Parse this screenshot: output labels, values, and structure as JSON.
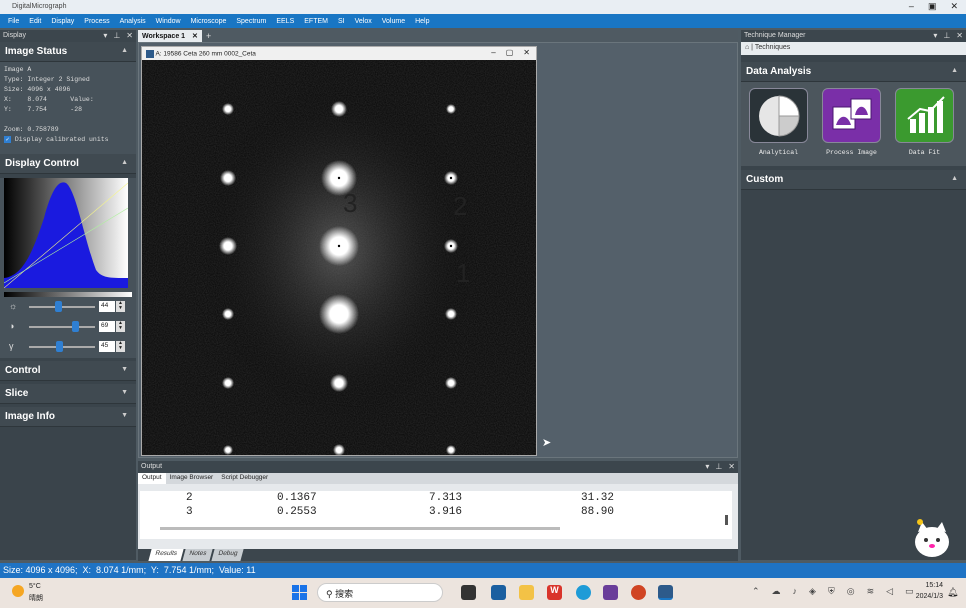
{
  "app": {
    "title": "DigitalMicrograph"
  },
  "menu": [
    "File",
    "Edit",
    "Display",
    "Process",
    "Analysis",
    "Window",
    "Microscope",
    "Spectrum",
    "EELS",
    "EFTEM",
    "SI",
    "Velox",
    "Volume",
    "Help"
  ],
  "display_panel": {
    "header": "Display",
    "image_status": {
      "title": "Image Status",
      "lines": [
        "Image A",
        "Type: Integer 2 Signed",
        "Size: 4096 x 4096",
        "X:    8.074      Value:",
        "Y:    7.754      -28",
        "",
        "Zoom: 0.758789"
      ],
      "calibrated_label": "Display calibrated units",
      "calibrated_checked": true
    },
    "display_control": {
      "title": "Display Control",
      "sliders": [
        {
          "icon": "brightness-icon",
          "value": "44",
          "fraction": 0.44
        },
        {
          "icon": "contrast-icon",
          "value": "69",
          "fraction": 0.69
        },
        {
          "icon": "gamma-icon",
          "value": "45",
          "fraction": 0.45
        }
      ]
    },
    "collapsed_sections": [
      "Control",
      "Slice",
      "Image Info"
    ]
  },
  "workspace": {
    "tab_label": "Workspace 1",
    "image_window_title": "A: 19586 Ceta 260 mm 0002_Ceta",
    "overlay_labels": [
      "3",
      "2",
      "1"
    ]
  },
  "output": {
    "header": "Output",
    "tabs": [
      "Output",
      "Image Browser",
      "Script Debugger"
    ],
    "rows": [
      [
        "2",
        "0.1367",
        "7.313",
        "31.32"
      ],
      [
        "3",
        "0.2553",
        "3.916",
        "88.90"
      ]
    ],
    "bottom_tabs": [
      "Results",
      "Notes",
      "Debug"
    ]
  },
  "technique_manager": {
    "header": "Technique Manager",
    "breadcrumb": "Techniques",
    "data_analysis": {
      "title": "Data Analysis",
      "tiles": [
        {
          "label": "Analytical",
          "icon": "pie-chart-icon",
          "color": "#d9d9d9"
        },
        {
          "label": "Process Image",
          "icon": "process-image-icon",
          "color": "#7a2fa8"
        },
        {
          "label": "Data Fit",
          "icon": "data-fit-icon",
          "color": "#3b9a2f"
        }
      ]
    },
    "custom": {
      "title": "Custom"
    }
  },
  "statusbar": {
    "text": "Size: 4096 x 4096;  X:  8.074 1/mm;  Y:  7.754 1/mm;  Value: 11"
  },
  "taskbar": {
    "weather_temp": "5°C",
    "weather_desc": "晴朗",
    "search_label": "搜索",
    "time": "15:14",
    "date": "2024/1/3"
  },
  "colors": {
    "accent": "#1976c4",
    "panel": "#3a444b",
    "section": "#404a51"
  }
}
